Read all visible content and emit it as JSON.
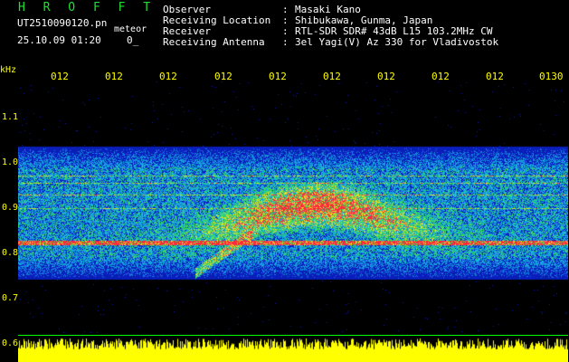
{
  "header": {
    "title": "H R O F F T",
    "filename": "UT2510090120.pn",
    "type": "meteor",
    "datetime": "25.10.09 01:20",
    "number": "0_"
  },
  "info": [
    {
      "key": "Observer",
      "value": "Masaki Kano"
    },
    {
      "key": "Receiving Location",
      "value": "Shibukawa, Gunma, Japan"
    },
    {
      "key": "Receiver",
      "value": "RTL-SDR SDR# 43dB L15 103.2MHz CW"
    },
    {
      "key": "Receiving Antenna",
      "value": "3el Yagi(V) Az 330 for Vladivostok"
    }
  ],
  "axis": {
    "unit": "kHz",
    "freq_labels": [
      "1.1",
      "1.0",
      "0.9",
      "0.8",
      "0.7",
      "0.6"
    ],
    "time_labels": [
      "012",
      "012",
      "012",
      "012",
      "012",
      "012",
      "012",
      "012",
      "012",
      "0130"
    ]
  },
  "colors": {
    "background": "#000000",
    "accent": "#ffff00",
    "title": "#20e030",
    "text": "#ffffff",
    "noise": "#0a2a8a",
    "echo": "#ff3030",
    "power": "#ffff00"
  }
}
